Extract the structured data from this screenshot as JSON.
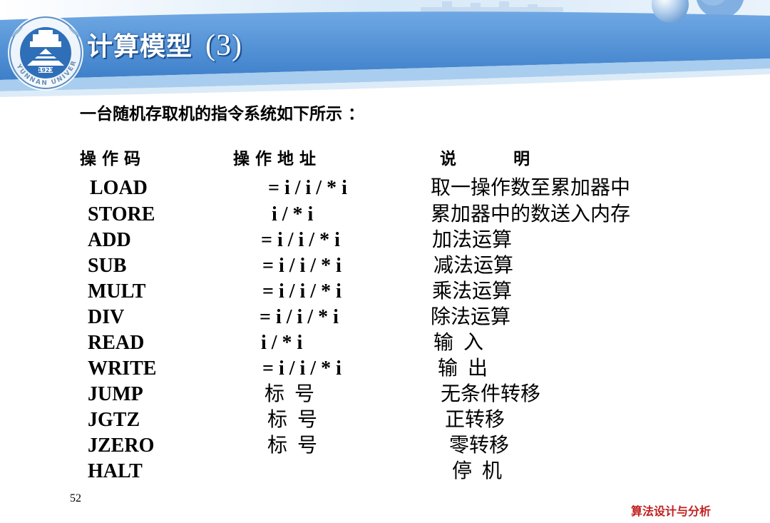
{
  "slide": {
    "title": "计算模型",
    "title_number": "(3)",
    "subtitle": "一台随机存取机的指令系统如下所示 ：",
    "columns": {
      "opcode": "操 作 码",
      "address": "操 作 地 址",
      "description": "说          明"
    },
    "rows": [
      {
        "op": "LOAD",
        "addr": "= i / i / * i",
        "desc": "取一操作数至累加器中"
      },
      {
        "op": "STORE",
        "addr": "i / * i",
        "desc": "累加器中的数送入内存"
      },
      {
        "op": "ADD",
        "addr": "= i / i / * i",
        "desc": "加法运算"
      },
      {
        "op": "SUB",
        "addr": "= i / i / * i",
        "desc": "减法运算"
      },
      {
        "op": "MULT",
        "addr": "= i / i / * i",
        "desc": "乘法运算"
      },
      {
        "op": "DIV",
        "addr": "= i / i / * i",
        "desc": "除法运算"
      },
      {
        "op": "READ",
        "addr": "i / * i",
        "desc": "输  入"
      },
      {
        "op": "WRITE",
        "addr": "= i / i / * i",
        "desc": "输  出"
      },
      {
        "op": "JUMP",
        "addr": "标  号",
        "desc": "无条件转移"
      },
      {
        "op": "JGTZ",
        "addr": "标  号",
        "desc": "正转移"
      },
      {
        "op": "JZERO",
        "addr": "标  号",
        "desc": "零转移"
      },
      {
        "op": "HALT",
        "addr": "",
        "desc": "停  机"
      }
    ],
    "page_number": "52",
    "footer": "算法设计与分析"
  },
  "logo": {
    "year": "1923",
    "text": "YUNNAN UNIVERSITY"
  },
  "colors": {
    "header_blue": "#4d8fd6",
    "header_light": "#a9cdee",
    "footer_red": "#c21f1f"
  }
}
